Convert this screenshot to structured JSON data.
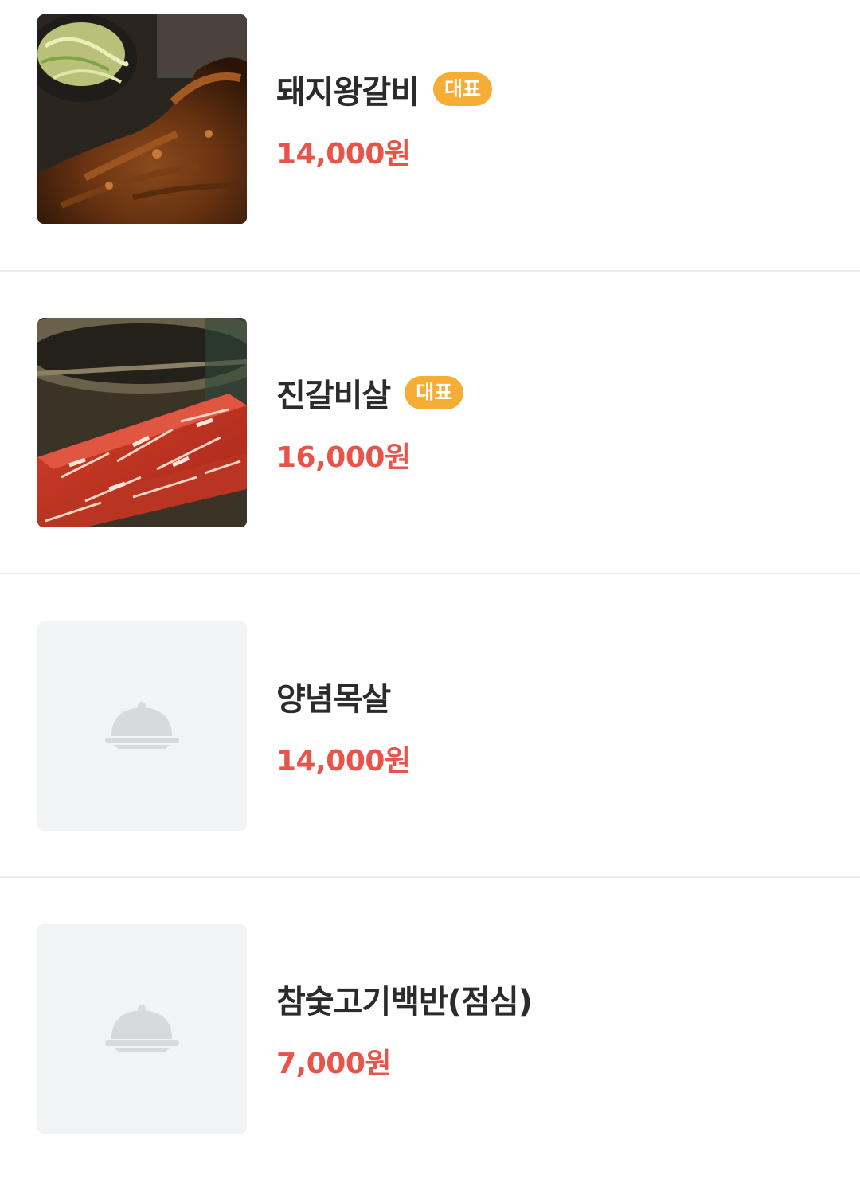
{
  "menu": {
    "items": [
      {
        "name": "돼지왕갈비",
        "badge": "대표",
        "price": "14,000원",
        "image": "grilled-pork-ribs-photo"
      },
      {
        "name": "진갈비살",
        "badge": "대표",
        "price": "16,000원",
        "image": "raw-marbled-rib-meat-photo"
      },
      {
        "name": "양념목살",
        "price": "14,000원",
        "image": "placeholder-cloche-icon"
      },
      {
        "name": "참숯고기백반(점심)",
        "price": "7,000원",
        "image": "placeholder-cloche-icon"
      }
    ]
  },
  "colors": {
    "badge": "#f6ad35",
    "price": "#e8534a",
    "name": "#2b2b2b",
    "placeholder_bg": "#f1f3f5",
    "placeholder_icon": "#d7d9dc",
    "divider": "#ececec"
  }
}
